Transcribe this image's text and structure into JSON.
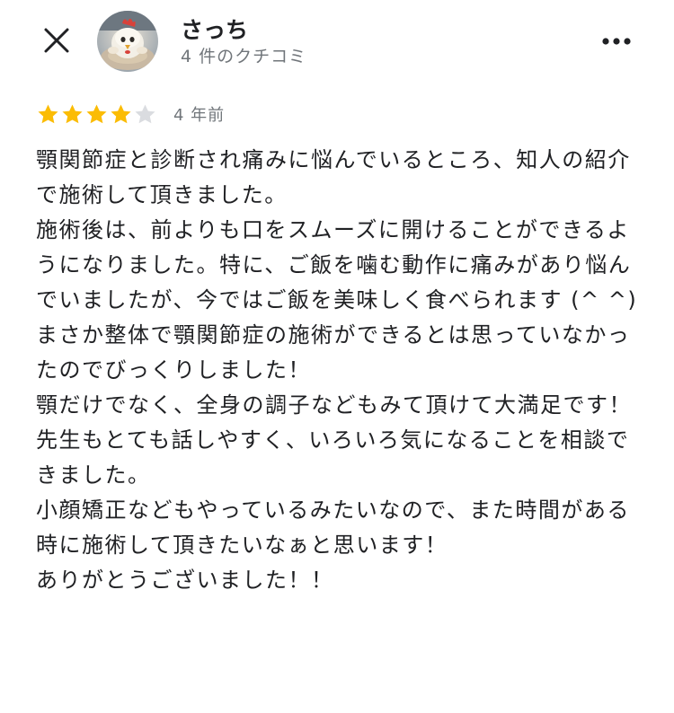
{
  "header": {
    "author_name": "さっち",
    "author_meta": "4 件のクチコミ",
    "close_icon": "close-icon",
    "more_icon": "more-horizontal-icon"
  },
  "rating": {
    "stars": 4,
    "max_stars": 5,
    "date": "4 年前",
    "filled_color": "#fbbc04",
    "empty_color": "#dadce0"
  },
  "review": {
    "text": "顎関節症と診断され痛みに悩んでいるところ、知人の紹介で施術して頂きました。\n施術後は、前よりも口をスムーズに開けることができるようになりました。特に、ご飯を噛む動作に痛みがあり悩んでいましたが、今ではご飯を美味しく食べられます (^ ^)\nまさか整体で顎関節症の施術ができるとは思っていなかったのでびっくりしました！\n顎だけでなく、全身の調子などもみて頂けて大満足です！先生もとても話しやすく、いろいろ気になることを相談できました。\n小顔矯正などもやっているみたいなので、また時間がある時に施術して頂きたいなぁと思います！\nありがとうございました！！"
  }
}
